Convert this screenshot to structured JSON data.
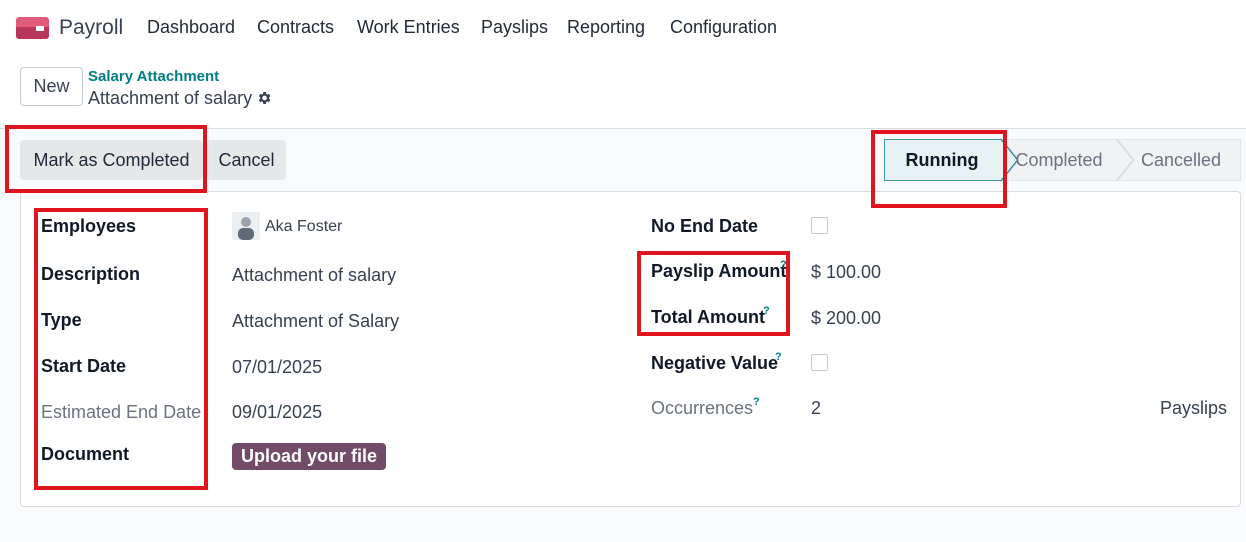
{
  "app": {
    "name": "Payroll",
    "logo_icon": "payroll-card-icon"
  },
  "nav": [
    "Dashboard",
    "Contracts",
    "Work Entries",
    "Payslips",
    "Reporting",
    "Configuration"
  ],
  "control": {
    "new_label": "New",
    "breadcrumb": "Salary Attachment",
    "record_name": "Attachment of salary",
    "settings_icon": "gear-icon"
  },
  "actions": {
    "mark_completed": "Mark as Completed",
    "cancel": "Cancel"
  },
  "stages": {
    "running": "Running",
    "completed": "Completed",
    "cancelled": "Cancelled",
    "active": "Running"
  },
  "form": {
    "left": {
      "employees_label": "Employees",
      "employee_name": "Aka Foster",
      "description_label": "Description",
      "description_value": "Attachment of salary",
      "type_label": "Type",
      "type_value": "Attachment of Salary",
      "start_date_label": "Start Date",
      "start_date_value": "07/01/2025",
      "estimated_end_label": "Estimated End Date",
      "estimated_end_value": "09/01/2025",
      "document_label": "Document",
      "upload_label": "Upload your file"
    },
    "right": {
      "no_end_date_label": "No End Date",
      "no_end_date_checked": false,
      "payslip_amount_label": "Payslip Amount",
      "payslip_amount_value": "$ 100.00",
      "total_amount_label": "Total Amount",
      "total_amount_value": "$ 200.00",
      "negative_value_label": "Negative Value",
      "negative_value_checked": false,
      "occurrences_label": "Occurrences",
      "occurrences_value": "2",
      "occurrences_unit": "Payslips"
    },
    "help_mark": "?"
  },
  "colors": {
    "accent": "#017e84",
    "brand": "#714b67",
    "highlight": "#e0141e"
  }
}
